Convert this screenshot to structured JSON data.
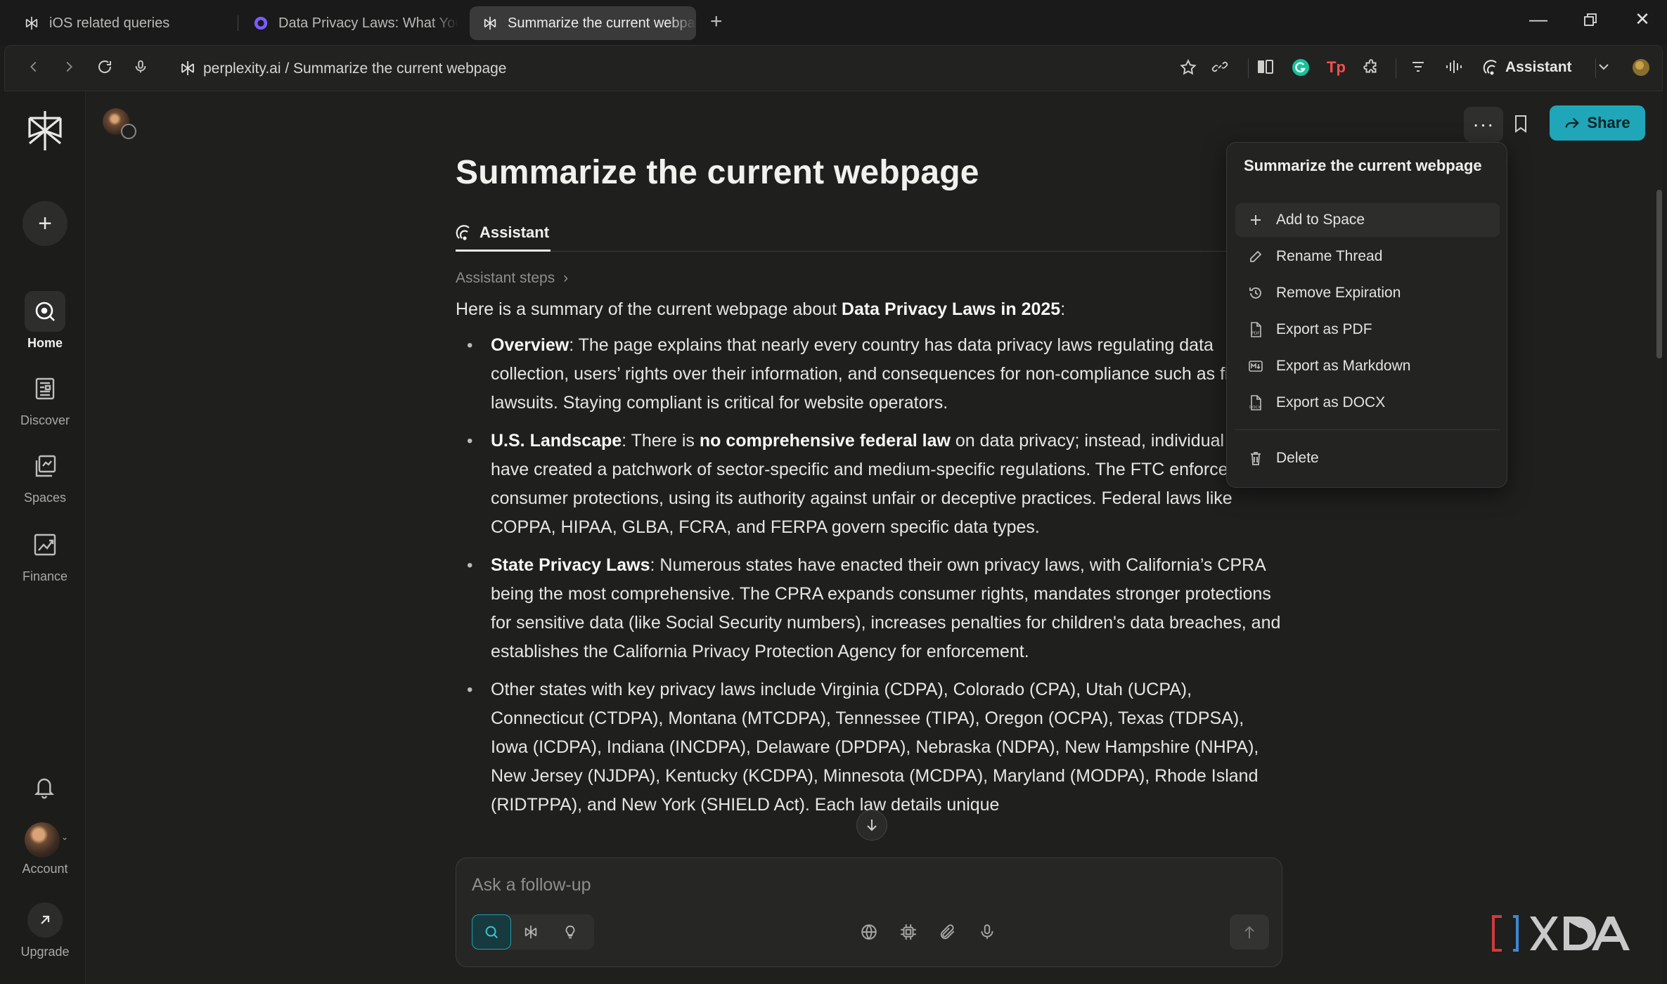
{
  "browser": {
    "tabs": [
      {
        "label": "iOS related queries"
      },
      {
        "label": "Data Privacy Laws: What You N"
      },
      {
        "label": "Summarize the current webpa"
      }
    ],
    "new_tab": "+",
    "url": "perplexity.ai / Summarize the current webpage",
    "assistant_label": "Assistant"
  },
  "sidebar": {
    "new_label": "+",
    "items": [
      {
        "label": "Home"
      },
      {
        "label": "Discover"
      },
      {
        "label": "Spaces"
      },
      {
        "label": "Finance"
      }
    ],
    "account_label": "Account",
    "upgrade_label": "Upgrade"
  },
  "thread": {
    "title": "Summarize the current webpage",
    "tab_label": "Assistant",
    "steps_label": "Assistant steps",
    "share_label": "Share",
    "more_label": "···"
  },
  "answer": {
    "intro_prefix": "Here is a summary of the current webpage about ",
    "intro_bold": "Data Privacy Laws in 2025",
    "intro_suffix": ":",
    "bullets": [
      {
        "bold": "Overview",
        "text": ": The page explains that nearly every country has data privacy laws regulating data collection, users’ rights over their information, and consequences for non-compliance such as fines or lawsuits. Staying compliant is critical for website operators."
      },
      {
        "bold": "U.S. Landscape",
        "text_a": ": There is ",
        "bold2": "no comprehensive federal law",
        "text_b": " on data privacy; instead, individual states have created a patchwork of sector-specific and medium-specific regulations. The FTC enforces consumer protections, using its authority against unfair or deceptive practices. Federal laws like COPPA, HIPAA, GLBA, FCRA, and FERPA govern specific data types."
      },
      {
        "bold": "State Privacy Laws",
        "text": ": Numerous states have enacted their own privacy laws, with California’s CPRA being the most comprehensive. The CPRA expands consumer rights, mandates stronger protections for sensitive data (like Social Security numbers), increases penalties for children's data breaches, and establishes the California Privacy Protection Agency for enforcement."
      },
      {
        "text": "Other states with key privacy laws include Virginia (CDPA), Colorado (CPA), Utah (UCPA), Connecticut (CTDPA), Montana (MTCDPA), Tennessee (TIPA), Oregon (OCPA), Texas (TDPSA), Iowa (ICDPA), Indiana (INCDPA), Delaware (DPDPA), Nebraska (NDPA), New Hampshire (NHPA), New Jersey (NJDPA), Kentucky (KCDPA), Minnesota (MCDPA), Maryland (MODPA), Rhode Island (RIDTPPA), and New York (SHIELD Act). Each law details unique"
      }
    ]
  },
  "composer": {
    "placeholder": "Ask a follow-up"
  },
  "menu": {
    "title": "Summarize the current webpage",
    "items": [
      {
        "label": "Add to Space",
        "icon": "plus-icon"
      },
      {
        "label": "Rename Thread",
        "icon": "pencil-icon"
      },
      {
        "label": "Remove Expiration",
        "icon": "clock-icon"
      },
      {
        "label": "Export as PDF",
        "icon": "pdf-file-icon"
      },
      {
        "label": "Export as Markdown",
        "icon": "markdown-file-icon"
      },
      {
        "label": "Export as DOCX",
        "icon": "docx-file-icon"
      },
      {
        "label": "Delete",
        "icon": "trash-icon"
      }
    ]
  },
  "colors": {
    "accent": "#1fa6b8",
    "background": "#1f1f1e",
    "menu_background": "#232322"
  }
}
